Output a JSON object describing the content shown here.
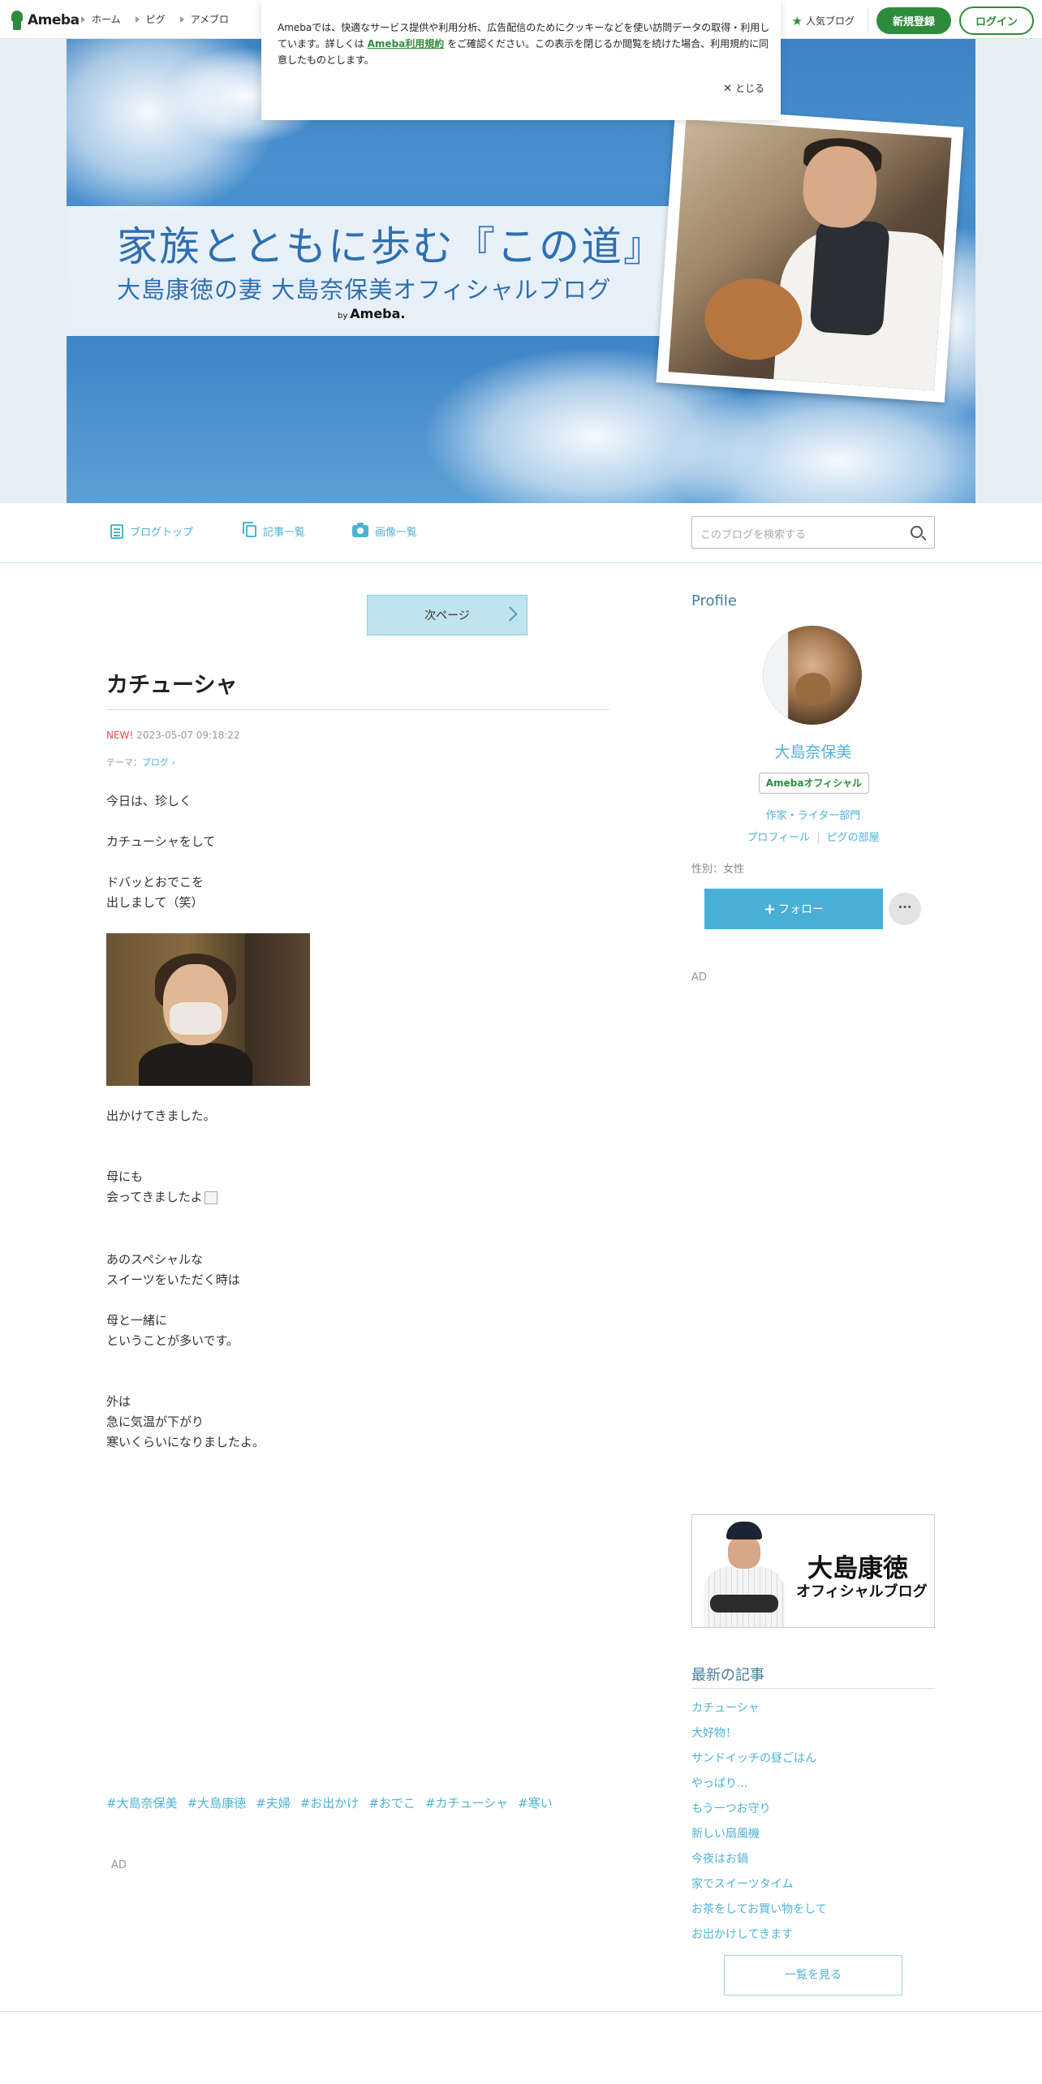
{
  "topbar": {
    "logo_text": "Ameba",
    "nav": [
      "ホーム",
      "ピグ",
      "アメブロ"
    ],
    "popular_label": "人気ブログ",
    "signup_label": "新規登録",
    "login_label": "ログイン"
  },
  "cookie": {
    "text_before": "Amebaでは、快適なサービス提供や利用分析、広告配信のためにクッキーなどを使い訪問データの取得・利用しています。詳しくは",
    "link": "Ameba利用規約",
    "text_after": "をご確認ください。この表示を閉じるか閲覧を続けた場合、利用規約に同意したものとします。",
    "close_label": "とじる"
  },
  "banner": {
    "title": "家族とともに歩む『この道』",
    "subtitle": "大島康徳の妻 大島奈保美オフィシャルブログ",
    "by": "by",
    "brand": "Ameba."
  },
  "blognav": {
    "top": "ブログトップ",
    "articles": "記事一覧",
    "images": "画像一覧",
    "search_placeholder": "このブログを検索する"
  },
  "post": {
    "next_page": "次ページ",
    "title": "カチューシャ",
    "new_label": "NEW!",
    "date": "2023-05-07 09:18:22",
    "theme_prefix": "テーマ：",
    "theme": "ブログ",
    "paragraphs": [
      [
        "今日は、珍しく"
      ],
      [
        "カチューシャをして"
      ],
      [
        "ドバッとおでこを",
        "出しまして（笑）"
      ],
      [
        "出かけてきました。"
      ],
      [
        "母にも",
        "会ってきましたよ"
      ],
      [
        "あのスペシャルな",
        "スイーツをいただく時は"
      ],
      [
        "母と一緒に",
        "ということが多いです。"
      ],
      [
        "外は",
        "急に気温が下がり",
        "寒いくらいになりましたよ。"
      ]
    ],
    "hashtags": [
      "#大島奈保美",
      "#大島康徳",
      "#夫婦",
      "#お出かけ",
      "#おでこ",
      "#カチューシャ",
      "#寒い"
    ],
    "ad_label": "AD"
  },
  "sidebar": {
    "profile_heading": "Profile",
    "name": "大島奈保美",
    "badge": "Amebaオフィシャル",
    "category": "作家・ライター部門",
    "link_profile": "プロフィール",
    "link_room": "ピグの部屋",
    "gender": "性別：女性",
    "follow_label": "フォロー",
    "more_label": "···",
    "ad_label": "AD",
    "banner_line1": "大島康徳",
    "banner_line2": "オフィシャルブログ",
    "latest_heading": "最新の記事",
    "latest": [
      "カチューシャ",
      "大好物！",
      "サンドイッチの昼ごはん",
      "やっぱり...",
      "もう一つお守り",
      "新しい扇風機",
      "今夜はお鍋",
      "家でスイーツタイム",
      "お茶をしてお買い物をして",
      "お出かけしてきます"
    ],
    "see_all": "一覧を見る"
  }
}
